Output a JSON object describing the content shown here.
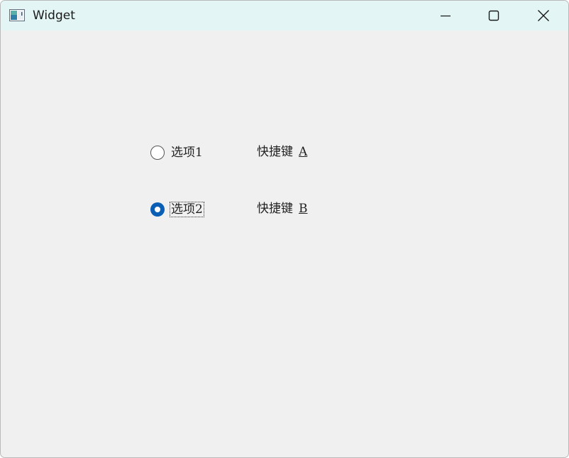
{
  "window": {
    "title": "Widget",
    "icon": "app-window-icon",
    "controls": {
      "minimize_icon": "minimize-icon",
      "maximize_icon": "maximize-icon",
      "close_icon": "close-icon"
    }
  },
  "options": [
    {
      "label": "选项1",
      "checked": false,
      "focused": false
    },
    {
      "label": "选项2",
      "checked": true,
      "focused": true
    }
  ],
  "shortcuts": [
    {
      "prefix": "快捷键",
      "key": "A"
    },
    {
      "prefix": "快捷键",
      "key": "B"
    }
  ],
  "colors": {
    "titlebar_bg": "#e3f6f5",
    "window_bg": "#f0f0f0",
    "radio_accent": "#0a5fb4"
  }
}
